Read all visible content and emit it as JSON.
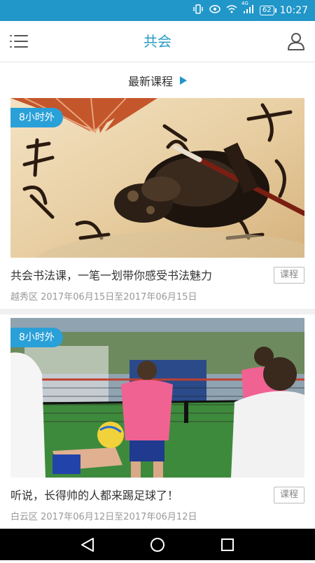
{
  "status_bar": {
    "signal_label": "4G",
    "battery": "62",
    "time": "10:27"
  },
  "header": {
    "title": "共会",
    "menu_icon": "list-menu-icon",
    "user_icon": "user-icon"
  },
  "section": {
    "title": "最新课程",
    "arrow_icon": "play-arrow-icon"
  },
  "courses": [
    {
      "badge": "8小时外",
      "title": "共会书法课，一笔一划带你感受书法魅力",
      "meta": "越秀区 2017年06月15日至2017年06月15日",
      "tag": "课程"
    },
    {
      "badge": "8小时外",
      "title": "听说，长得帅的人都来踢足球了！",
      "meta": "白云区 2017年06月12日至2017年06月12日",
      "tag": "课程"
    }
  ],
  "colors": {
    "status_bar": "#2196c9",
    "accent": "#2a9bc5",
    "badge": "#2aa0d8"
  }
}
